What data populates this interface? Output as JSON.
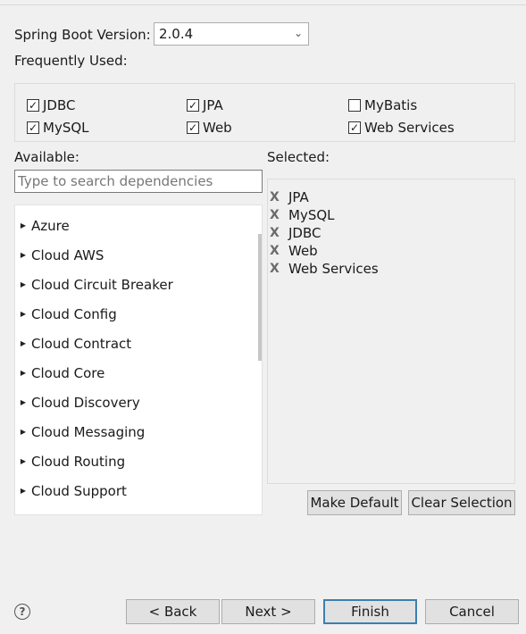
{
  "spring_boot": {
    "label": "Spring Boot Version:",
    "value": "2.0.4"
  },
  "frequently_used": {
    "label": "Frequently Used:",
    "items": [
      {
        "label": "JDBC",
        "checked": true
      },
      {
        "label": "JPA",
        "checked": true
      },
      {
        "label": "MyBatis",
        "checked": false
      },
      {
        "label": "MySQL",
        "checked": true
      },
      {
        "label": "Web",
        "checked": true
      },
      {
        "label": "Web Services",
        "checked": true
      }
    ]
  },
  "available": {
    "label": "Available:",
    "search_placeholder": "Type to search dependencies",
    "categories": [
      "Azure",
      "Cloud AWS",
      "Cloud Circuit Breaker",
      "Cloud Config",
      "Cloud Contract",
      "Cloud Core",
      "Cloud Discovery",
      "Cloud Messaging",
      "Cloud Routing",
      "Cloud Support"
    ]
  },
  "selected": {
    "label": "Selected:",
    "remove_glyph": "X",
    "items": [
      "JPA",
      "MySQL",
      "JDBC",
      "Web",
      "Web Services"
    ]
  },
  "buttons": {
    "make_default": "Make Default",
    "clear_selection": "Clear Selection",
    "back": "< Back",
    "next": "Next >",
    "finish": "Finish",
    "cancel": "Cancel"
  },
  "icons": {
    "help": "question-mark-icon",
    "check": "check-icon",
    "expand": "chevron-right-icon"
  }
}
